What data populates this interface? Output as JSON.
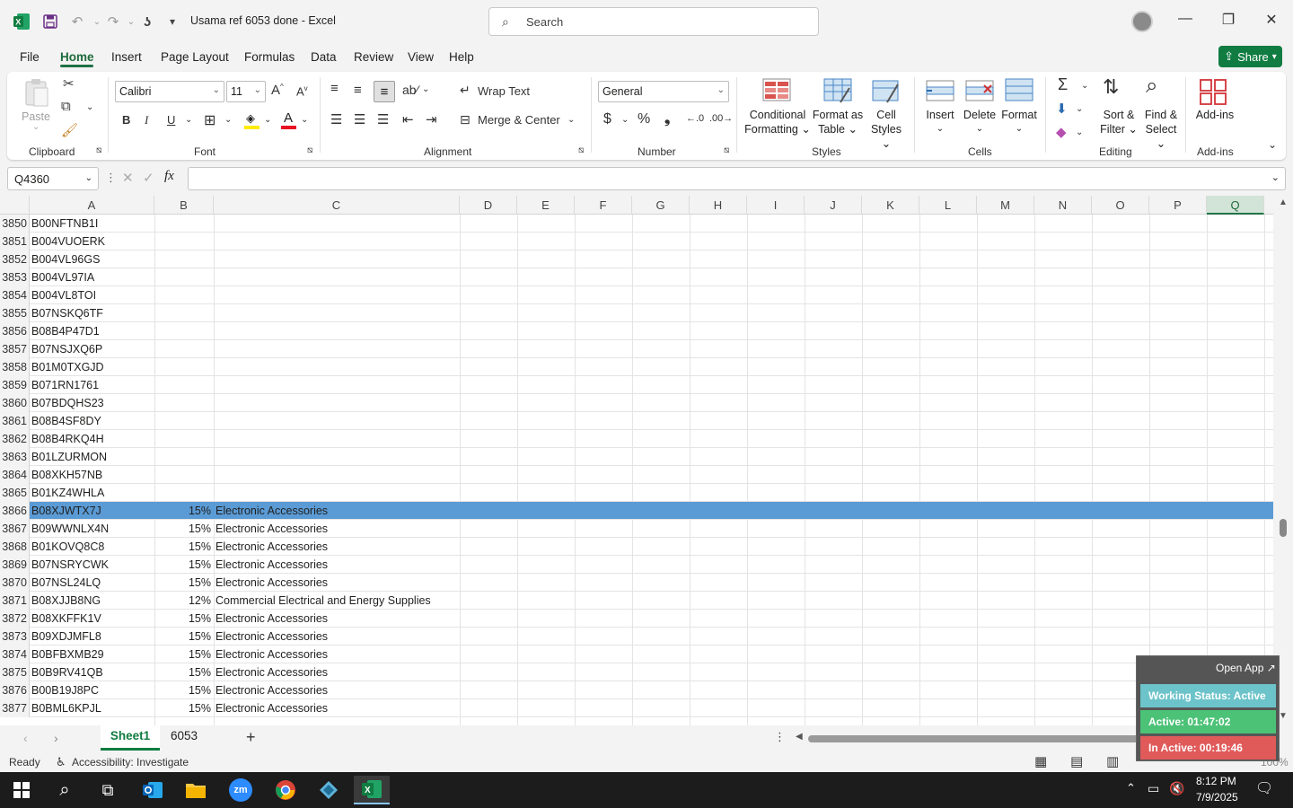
{
  "window": {
    "title": "Usama ref 6053 done  -  Excel",
    "search_placeholder": "Search"
  },
  "menu": [
    "File",
    "Home",
    "Insert",
    "Page Layout",
    "Formulas",
    "Data",
    "Review",
    "View",
    "Help"
  ],
  "share_label": "Share",
  "ribbon": {
    "clipboard": {
      "paste": "Paste",
      "label": "Clipboard"
    },
    "font": {
      "name": "Calibri",
      "size": "11",
      "label": "Font"
    },
    "alignment": {
      "wrap": "Wrap Text",
      "merge": "Merge & Center",
      "label": "Alignment"
    },
    "number": {
      "format": "General",
      "label": "Number"
    },
    "styles": {
      "cond": [
        "Conditional",
        "Formatting"
      ],
      "fmt_table": [
        "Format as",
        "Table"
      ],
      "cell_styles": [
        "Cell",
        "Styles"
      ],
      "label": "Styles"
    },
    "cells": {
      "insert": "Insert",
      "delete": "Delete",
      "format": "Format",
      "label": "Cells"
    },
    "editing": {
      "sort": [
        "Sort &",
        "Filter"
      ],
      "find": [
        "Find &",
        "Select"
      ],
      "label": "Editing"
    },
    "addins": {
      "btn": "Add-ins",
      "label": "Add-ins"
    }
  },
  "namebox": "Q4360",
  "columns": [
    "A",
    "B",
    "C",
    "D",
    "E",
    "F",
    "G",
    "H",
    "I",
    "J",
    "K",
    "L",
    "M",
    "N",
    "O",
    "P",
    "Q"
  ],
  "rows": [
    {
      "n": "3850",
      "a": "B00NFTNB1I",
      "b": "",
      "c": ""
    },
    {
      "n": "3851",
      "a": "B004VUOERK",
      "b": "",
      "c": ""
    },
    {
      "n": "3852",
      "a": "B004VL96GS",
      "b": "",
      "c": ""
    },
    {
      "n": "3853",
      "a": "B004VL97IA",
      "b": "",
      "c": ""
    },
    {
      "n": "3854",
      "a": "B004VL8TOI",
      "b": "",
      "c": ""
    },
    {
      "n": "3855",
      "a": "B07NSKQ6TF",
      "b": "",
      "c": ""
    },
    {
      "n": "3856",
      "a": "B08B4P47D1",
      "b": "",
      "c": ""
    },
    {
      "n": "3857",
      "a": "B07NSJXQ6P",
      "b": "",
      "c": ""
    },
    {
      "n": "3858",
      "a": "B01M0TXGJD",
      "b": "",
      "c": ""
    },
    {
      "n": "3859",
      "a": "B071RN1761",
      "b": "",
      "c": ""
    },
    {
      "n": "3860",
      "a": "B07BDQHS23",
      "b": "",
      "c": ""
    },
    {
      "n": "3861",
      "a": "B08B4SF8DY",
      "b": "",
      "c": ""
    },
    {
      "n": "3862",
      "a": "B08B4RKQ4H",
      "b": "",
      "c": ""
    },
    {
      "n": "3863",
      "a": "B01LZURMON",
      "b": "",
      "c": ""
    },
    {
      "n": "3864",
      "a": "B08XKH57NB",
      "b": "",
      "c": ""
    },
    {
      "n": "3865",
      "a": "B01KZ4WHLA",
      "b": "",
      "c": ""
    },
    {
      "n": "3866",
      "a": "B08XJWTX7J",
      "b": "15%",
      "c": "Electronic Accessories"
    },
    {
      "n": "3867",
      "a": "B09WWNLX4N",
      "b": "15%",
      "c": "Electronic Accessories"
    },
    {
      "n": "3868",
      "a": "B01KOVQ8C8",
      "b": "15%",
      "c": "Electronic Accessories"
    },
    {
      "n": "3869",
      "a": "B07NSRYCWK",
      "b": "15%",
      "c": "Electronic Accessories"
    },
    {
      "n": "3870",
      "a": "B07NSL24LQ",
      "b": "15%",
      "c": "Electronic Accessories"
    },
    {
      "n": "3871",
      "a": "B08XJJB8NG",
      "b": "12%",
      "c": "Commercial Electrical and Energy Supplies"
    },
    {
      "n": "3872",
      "a": "B08XKFFK1V",
      "b": "15%",
      "c": "Electronic Accessories"
    },
    {
      "n": "3873",
      "a": "B09XDJMFL8",
      "b": "15%",
      "c": "Electronic Accessories"
    },
    {
      "n": "3874",
      "a": "B0BFBXMB29",
      "b": "15%",
      "c": "Electronic Accessories"
    },
    {
      "n": "3875",
      "a": "B0B9RV41QB",
      "b": "15%",
      "c": "Electronic Accessories"
    },
    {
      "n": "3876",
      "a": "B00B19J8PC",
      "b": "15%",
      "c": "Electronic Accessories"
    },
    {
      "n": "3877",
      "a": "B0BML6KPJL",
      "b": "15%",
      "c": "Electronic Accessories"
    }
  ],
  "highlighted_row": "3866",
  "sheets": [
    "Sheet1",
    "6053"
  ],
  "status": {
    "ready": "Ready",
    "accessibility": "Accessibility: Investigate",
    "zoom": "100%"
  },
  "widget": {
    "open_app": "Open App ↗",
    "working": "Working Status: Active",
    "active": "Active: 01:47:02",
    "inactive": "In Active: 00:19:46"
  },
  "clock": {
    "time": "8:12 PM",
    "date": "7/9/2025"
  },
  "colors": {
    "excel_green": "#107c41",
    "highlight": "#5b9bd5",
    "widget_blue": "#6cc3c9",
    "widget_green": "#4cc277",
    "widget_red": "#e05a5a"
  }
}
